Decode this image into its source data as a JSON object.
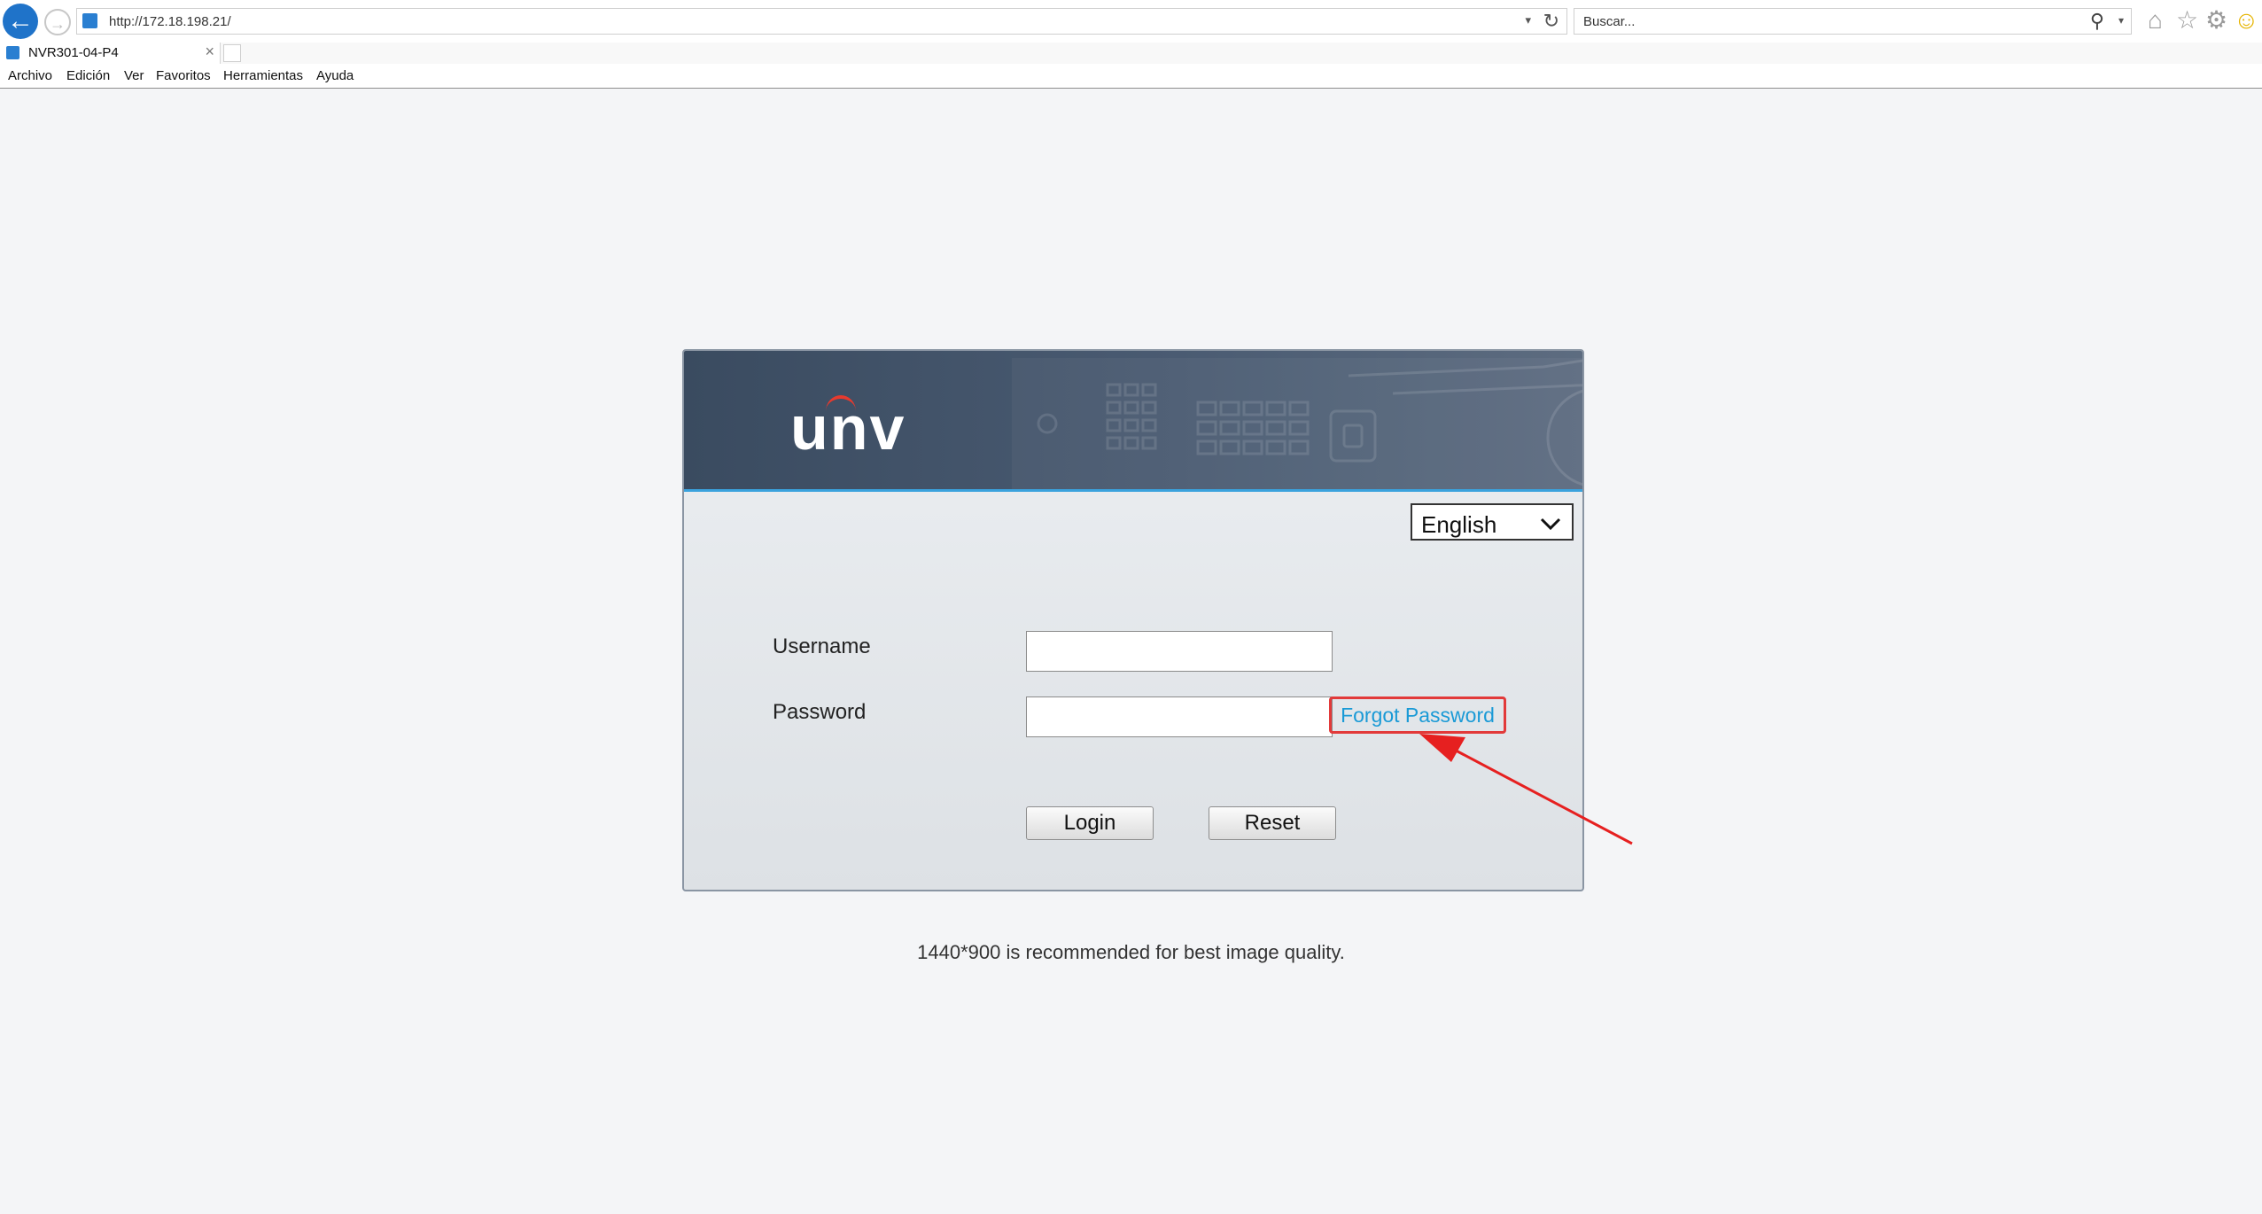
{
  "browser": {
    "url": "http://172.18.198.21/",
    "search_placeholder": "Buscar...",
    "tab_title": "NVR301-04-P4",
    "menu": [
      "Archivo",
      "Edición",
      "Ver",
      "Favoritos",
      "Herramientas",
      "Ayuda"
    ]
  },
  "login": {
    "logo": "unv",
    "language": "English",
    "username_label": "Username",
    "password_label": "Password",
    "forgot_password": "Forgot Password",
    "login_button": "Login",
    "reset_button": "Reset",
    "hint": "1440*900 is recommended for best image quality."
  },
  "colors": {
    "banner": "#44546a",
    "accent_line": "#3aa2dd",
    "forgot_link": "#1a9ad6",
    "annotation": "#e23a3a"
  }
}
